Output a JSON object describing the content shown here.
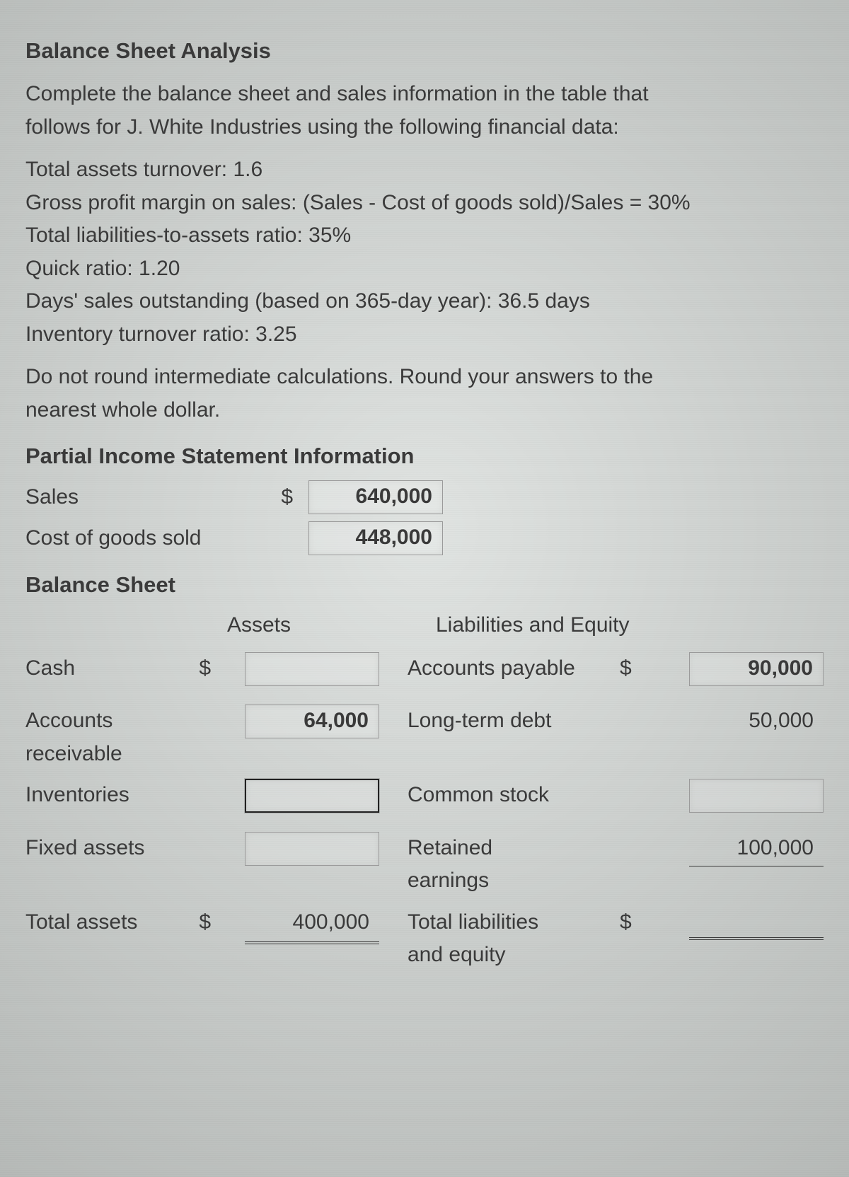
{
  "title": "Balance Sheet Analysis",
  "intro1": "Complete the balance sheet and sales information in the table that",
  "intro2": "follows for J. White Industries using the following financial data:",
  "data": {
    "l1": "Total assets turnover: 1.6",
    "l2": "Gross profit margin on sales: (Sales - Cost of goods sold)/Sales = 30%",
    "l3": "Total liabilities-to-assets ratio: 35%",
    "l4": "Quick ratio: 1.20",
    "l5": "Days' sales outstanding (based on 365-day year): 36.5 days",
    "l6": "Inventory turnover ratio: 3.25"
  },
  "note1": "Do not round intermediate calculations. Round your answers to the",
  "note2": "nearest whole dollar.",
  "is_head": "Partial Income Statement Information",
  "is": {
    "sales_label": "Sales",
    "sales_value": "640,000",
    "cogs_label": "Cost of goods sold",
    "cogs_value": "448,000"
  },
  "bs_head": "Balance Sheet",
  "bs": {
    "assets_head": "Assets",
    "liab_head": "Liabilities and Equity",
    "cash_label": "Cash",
    "cash_value": "",
    "ar_label1": "Accounts",
    "ar_label2": "receivable",
    "ar_value": "64,000",
    "inv_label": "Inventories",
    "inv_value": "",
    "fa_label": "Fixed assets",
    "fa_value": "",
    "ta_label": "Total assets",
    "ta_value": "400,000",
    "ap_label": "Accounts payable",
    "ap_value": "90,000",
    "ltd_label": "Long-term debt",
    "ltd_value": "50,000",
    "cs_label": "Common stock",
    "cs_value": "",
    "re_label1": "Retained",
    "re_label2": "earnings",
    "re_value": "100,000",
    "tle_label1": "Total liabilities",
    "tle_label2": "and equity",
    "tle_value": ""
  },
  "dollar": "$"
}
